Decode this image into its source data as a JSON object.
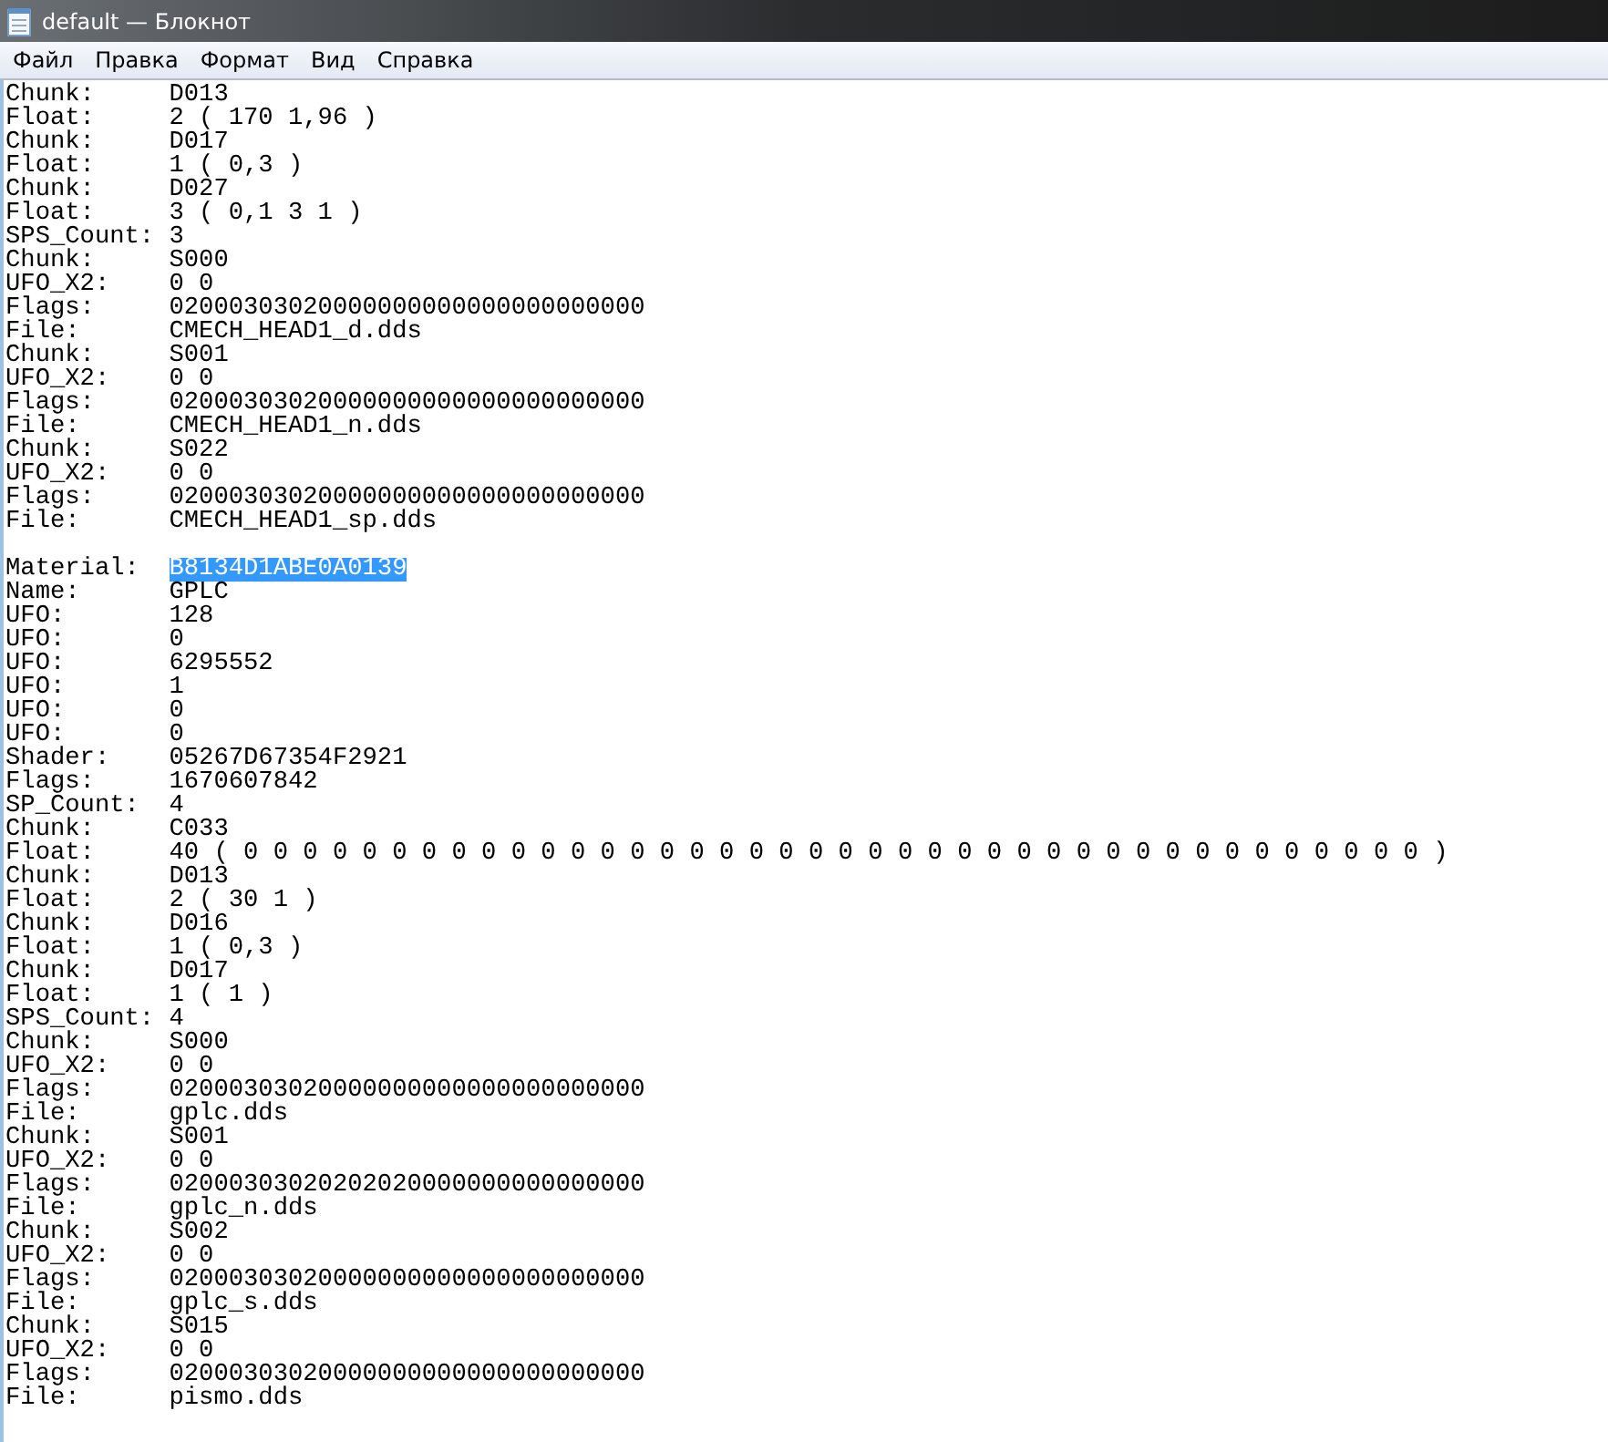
{
  "window": {
    "title": "default — Блокнот"
  },
  "menu": [
    "Файл",
    "Правка",
    "Формат",
    "Вид",
    "Справка"
  ],
  "sections": [
    {
      "lines": [
        {
          "label": "Chunk:",
          "value": "D013",
          "selected": false
        },
        {
          "label": "Float:",
          "value": "2 ( 170 1,96 )",
          "selected": false
        },
        {
          "label": "Chunk:",
          "value": "D017",
          "selected": false
        },
        {
          "label": "Float:",
          "value": "1 ( 0,3 )",
          "selected": false
        },
        {
          "label": "Chunk:",
          "value": "D027",
          "selected": false
        },
        {
          "label": "Float:",
          "value": "3 ( 0,1 3 1 )",
          "selected": false
        },
        {
          "label": "SPS_Count:",
          "value": "3",
          "selected": false
        },
        {
          "label": "Chunk:",
          "value": "S000",
          "selected": false
        },
        {
          "label": "UFO_X2:",
          "value": "0 0",
          "selected": false
        },
        {
          "label": "Flags:",
          "value": "02000303020000000000000000000000",
          "selected": false
        },
        {
          "label": "File:",
          "value": "CMECH_HEAD1_d.dds",
          "selected": false
        },
        {
          "label": "Chunk:",
          "value": "S001",
          "selected": false
        },
        {
          "label": "UFO_X2:",
          "value": "0 0",
          "selected": false
        },
        {
          "label": "Flags:",
          "value": "02000303020000000000000000000000",
          "selected": false
        },
        {
          "label": "File:",
          "value": "CMECH_HEAD1_n.dds",
          "selected": false
        },
        {
          "label": "Chunk:",
          "value": "S022",
          "selected": false
        },
        {
          "label": "UFO_X2:",
          "value": "0 0",
          "selected": false
        },
        {
          "label": "Flags:",
          "value": "02000303020000000000000000000000",
          "selected": false
        },
        {
          "label": "File:",
          "value": "CMECH_HEAD1_sp.dds",
          "selected": false
        }
      ]
    },
    {
      "lines": [
        {
          "label": "Material:",
          "value": "B8134D1ABE0A0139",
          "selected": true
        },
        {
          "label": "Name:",
          "value": "GPLC",
          "selected": false
        },
        {
          "label": "UFO:",
          "value": "128",
          "selected": false
        },
        {
          "label": "UFO:",
          "value": "0",
          "selected": false
        },
        {
          "label": "UFO:",
          "value": "6295552",
          "selected": false
        },
        {
          "label": "UFO:",
          "value": "1",
          "selected": false
        },
        {
          "label": "UFO:",
          "value": "0",
          "selected": false
        },
        {
          "label": "UFO:",
          "value": "0",
          "selected": false
        },
        {
          "label": "Shader:",
          "value": "05267D67354F2921",
          "selected": false
        },
        {
          "label": "Flags:",
          "value": "1670607842",
          "selected": false
        },
        {
          "label": "SP_Count:",
          "value": "4",
          "selected": false
        },
        {
          "label": "Chunk:",
          "value": "C033",
          "selected": false
        },
        {
          "label": "Float:",
          "value": "40 ( 0 0 0 0 0 0 0 0 0 0 0 0 0 0 0 0 0 0 0 0 0 0 0 0 0 0 0 0 0 0 0 0 0 0 0 0 0 0 0 0 )",
          "selected": false
        },
        {
          "label": "Chunk:",
          "value": "D013",
          "selected": false
        },
        {
          "label": "Float:",
          "value": "2 ( 30 1 )",
          "selected": false
        },
        {
          "label": "Chunk:",
          "value": "D016",
          "selected": false
        },
        {
          "label": "Float:",
          "value": "1 ( 0,3 )",
          "selected": false
        },
        {
          "label": "Chunk:",
          "value": "D017",
          "selected": false
        },
        {
          "label": "Float:",
          "value": "1 ( 1 )",
          "selected": false
        },
        {
          "label": "SPS_Count:",
          "value": "4",
          "selected": false
        },
        {
          "label": "Chunk:",
          "value": "S000",
          "selected": false
        },
        {
          "label": "UFO_X2:",
          "value": "0 0",
          "selected": false
        },
        {
          "label": "Flags:",
          "value": "02000303020000000000000000000000",
          "selected": false
        },
        {
          "label": "File:",
          "value": "gplc.dds",
          "selected": false
        },
        {
          "label": "Chunk:",
          "value": "S001",
          "selected": false
        },
        {
          "label": "UFO_X2:",
          "value": "0 0",
          "selected": false
        },
        {
          "label": "Flags:",
          "value": "02000303020202020000000000000000",
          "selected": false
        },
        {
          "label": "File:",
          "value": "gplc_n.dds",
          "selected": false
        },
        {
          "label": "Chunk:",
          "value": "S002",
          "selected": false
        },
        {
          "label": "UFO_X2:",
          "value": "0 0",
          "selected": false
        },
        {
          "label": "Flags:",
          "value": "02000303020000000000000000000000",
          "selected": false
        },
        {
          "label": "File:",
          "value": "gplc_s.dds",
          "selected": false
        },
        {
          "label": "Chunk:",
          "value": "S015",
          "selected": false
        },
        {
          "label": "UFO_X2:",
          "value": "0 0",
          "selected": false
        },
        {
          "label": "Flags:",
          "value": "02000303020000000000000000000000",
          "selected": false
        },
        {
          "label": "File:",
          "value": "pismo.dds",
          "selected": false
        }
      ]
    }
  ]
}
